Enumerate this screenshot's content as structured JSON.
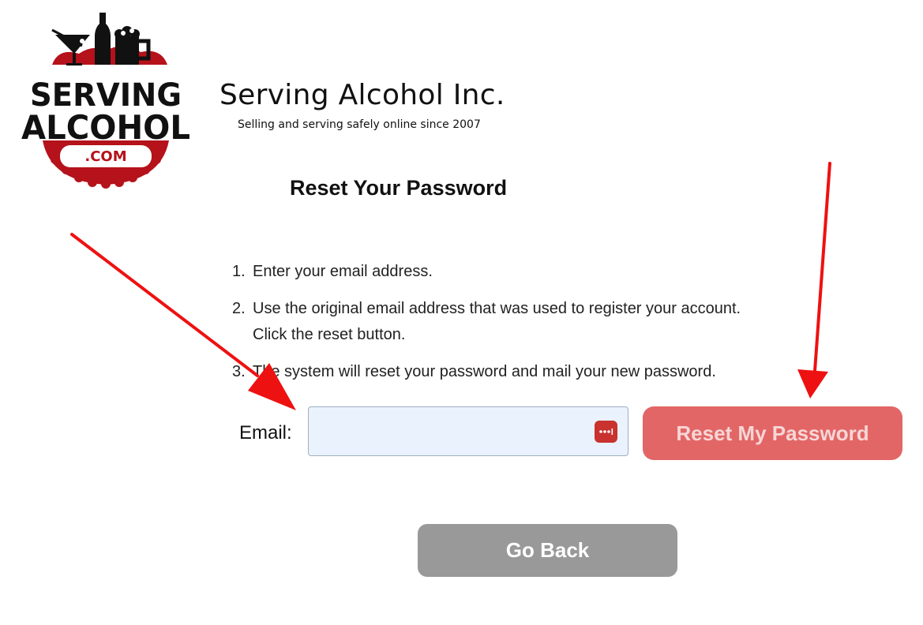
{
  "brand": {
    "logo": {
      "line1": "SERVING",
      "line2": "ALCOHOL",
      "badge": ".COM",
      "primary_color": "#111111",
      "accent_color": "#b5121b"
    },
    "company_name": "Serving Alcohol Inc.",
    "tagline": "Selling and serving safely online since 2007"
  },
  "page": {
    "title": "Reset Your Password"
  },
  "instructions": [
    {
      "number": "1.",
      "text": "Enter your email address."
    },
    {
      "number": "2.",
      "text": "Use the original email address that was used to register your account. Click the reset button."
    },
    {
      "number": "3.",
      "text": "The system will reset your password and mail your new password."
    }
  ],
  "form": {
    "email_label": "Email:",
    "email_value": "",
    "password_manager_icon": "password-manager-icon",
    "reset_button_label": "Reset My Password",
    "back_button_label": "Go Back"
  },
  "colors": {
    "reset_button": "#e36666",
    "back_button": "#999999",
    "input_background": "#e9f2fd",
    "annotation_arrow": "#ee1111"
  }
}
